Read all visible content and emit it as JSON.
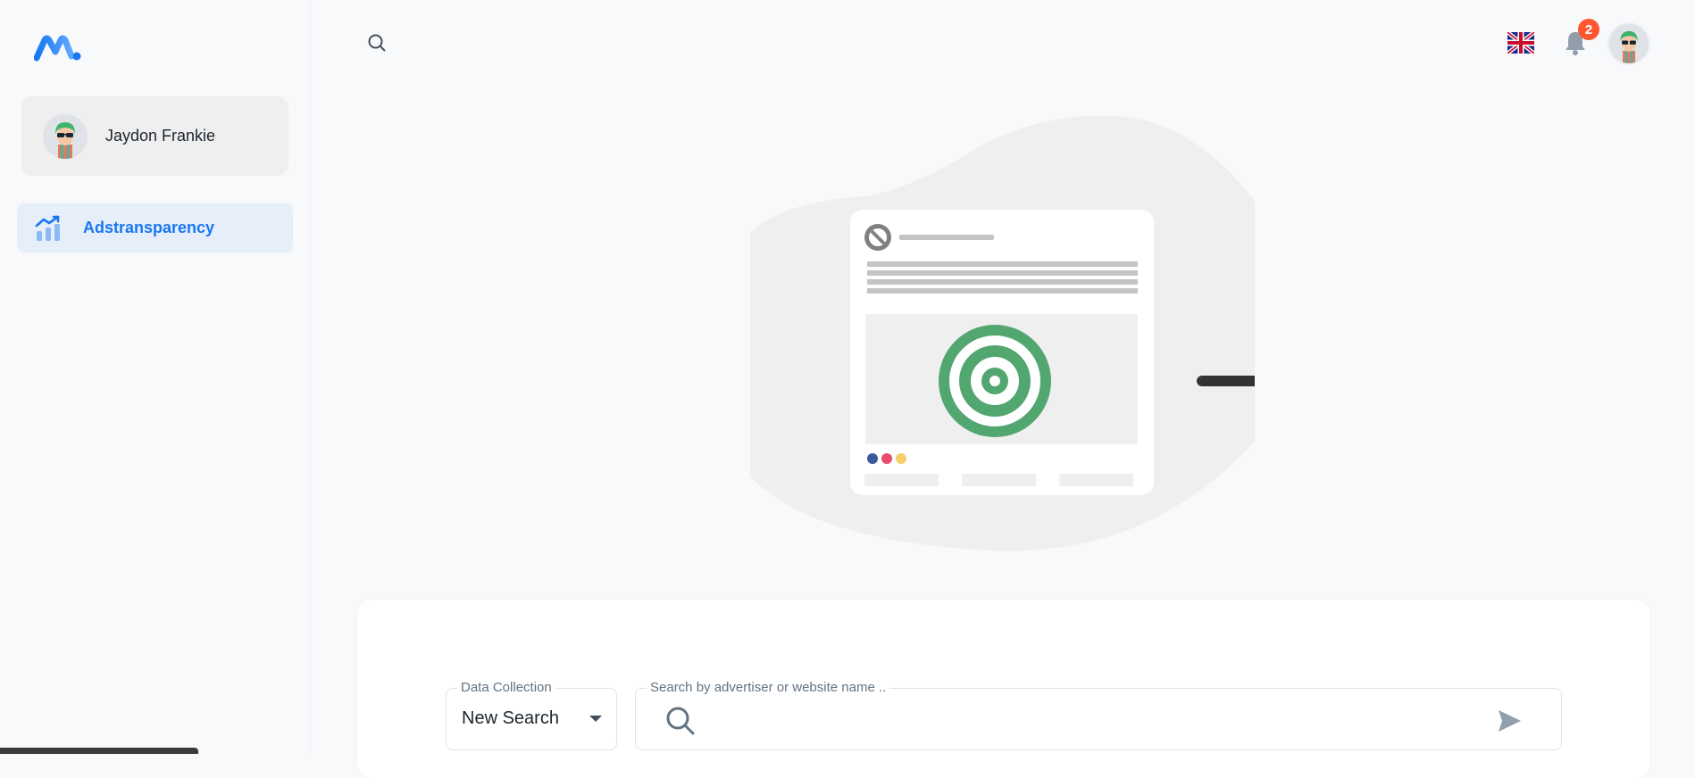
{
  "app": {
    "brand_color": "#1877f2",
    "logo_icon": "logo-icon"
  },
  "sidebar": {
    "user": {
      "name": "Jaydon Frankie",
      "avatar": "avatar-image"
    },
    "items": [
      {
        "label": "Adstransparency",
        "icon": "chart-icon",
        "active": true
      }
    ]
  },
  "header": {
    "search_icon": "search-icon",
    "language_icon": "uk-flag-icon",
    "notifications": {
      "icon": "bell-icon",
      "count": "2"
    },
    "avatar": "avatar-image"
  },
  "illustration": {
    "name": "ad-target-illustration",
    "accent": "#52a66f"
  },
  "search_form": {
    "data_collection": {
      "label": "Data Collection",
      "value": "New Search"
    },
    "query": {
      "label": "Search by advertiser or website name ..",
      "value": "",
      "placeholder": ""
    },
    "send_icon": "send-icon"
  }
}
